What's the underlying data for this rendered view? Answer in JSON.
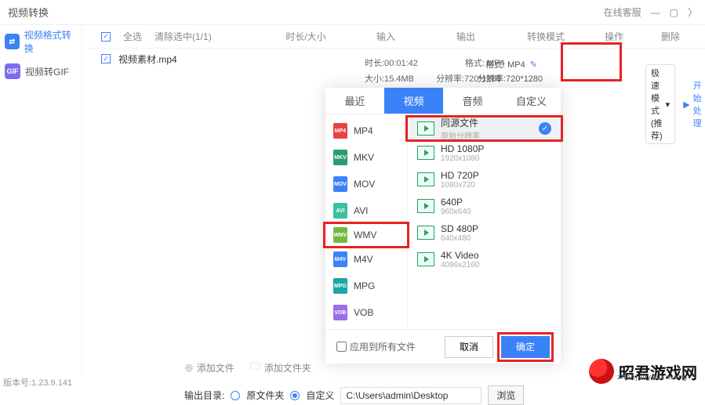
{
  "titlebar": {
    "title": "视频转换",
    "support": "在线客服"
  },
  "sidebar": {
    "items": [
      {
        "icon": "⇄",
        "label": "视频格式转换"
      },
      {
        "icon": "GIF",
        "label": "视频转GIF"
      }
    ]
  },
  "listhead": {
    "select_all": "全选",
    "clear_sel": "清除选中(1/1)",
    "cols": {
      "duration": "时长/大小",
      "input": "输入",
      "output": "输出",
      "mode": "转换模式",
      "op": "操作",
      "del": "删除"
    }
  },
  "file": {
    "name": "视频素材.mp4",
    "duration": "时长:00:01:42",
    "size": "大小:15.4MB",
    "in_fmt": "格式: MP4",
    "in_res": "分辨率:720*1280",
    "out_fmt": "格式: MP4",
    "out_res": "分辨率:720*1280"
  },
  "speed": {
    "label": "极速模式(推荐)",
    "start": "开始处理"
  },
  "popup": {
    "tabs": {
      "recent": "最近",
      "video": "视频",
      "audio": "音频",
      "custom": "自定义"
    },
    "formats": [
      "MP4",
      "MKV",
      "MOV",
      "AVI",
      "WMV",
      "M4V",
      "MPG",
      "VOB"
    ],
    "presets": [
      {
        "t1": "同源文件",
        "t2": "原始分辨率",
        "sel": true
      },
      {
        "t1": "HD 1080P",
        "t2": "1920x1080"
      },
      {
        "t1": "HD 720P",
        "t2": "1080x720"
      },
      {
        "t1": "640P",
        "t2": "960x640"
      },
      {
        "t1": "SD 480P",
        "t2": "640x480"
      },
      {
        "t1": "4K Video",
        "t2": "4096x2160"
      }
    ],
    "apply_all": "应用到所有文件",
    "cancel": "取消",
    "ok": "确定"
  },
  "add": {
    "file": "添加文件",
    "folder": "添加文件夹"
  },
  "out": {
    "label": "输出目录:",
    "orig": "原文件夹",
    "custom": "自定义",
    "path": "C:\\Users\\admin\\Desktop",
    "browse": "浏览"
  },
  "version": "版本号:1.23.9.141",
  "watermark": {
    "name": "昭君游戏网",
    "url": "zhaojunyouxiwang"
  }
}
